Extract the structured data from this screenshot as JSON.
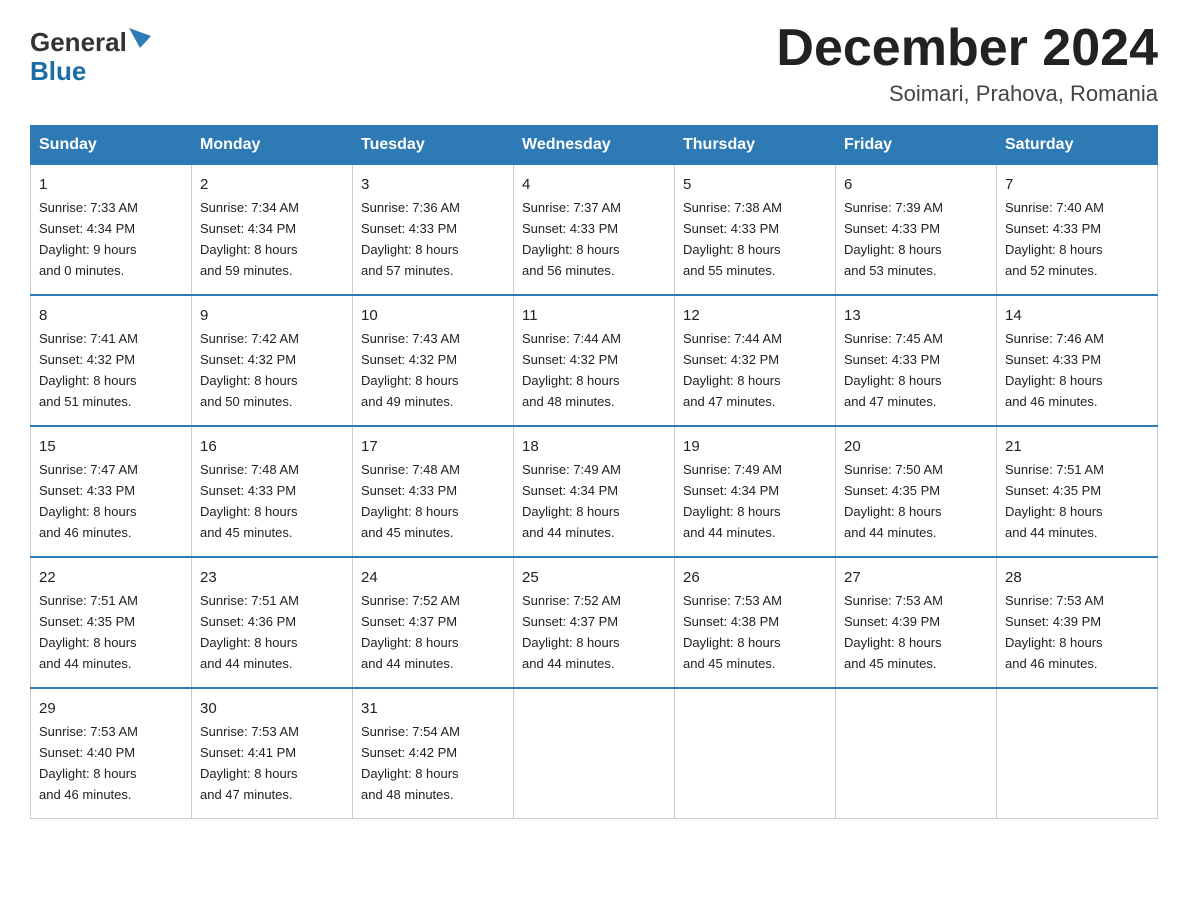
{
  "header": {
    "logo_general": "General",
    "logo_blue": "Blue",
    "month_title": "December 2024",
    "location": "Soimari, Prahova, Romania"
  },
  "days_of_week": [
    "Sunday",
    "Monday",
    "Tuesday",
    "Wednesday",
    "Thursday",
    "Friday",
    "Saturday"
  ],
  "weeks": [
    [
      {
        "day": "1",
        "sunrise": "7:33 AM",
        "sunset": "4:34 PM",
        "daylight": "9 hours and 0 minutes."
      },
      {
        "day": "2",
        "sunrise": "7:34 AM",
        "sunset": "4:34 PM",
        "daylight": "8 hours and 59 minutes."
      },
      {
        "day": "3",
        "sunrise": "7:36 AM",
        "sunset": "4:33 PM",
        "daylight": "8 hours and 57 minutes."
      },
      {
        "day": "4",
        "sunrise": "7:37 AM",
        "sunset": "4:33 PM",
        "daylight": "8 hours and 56 minutes."
      },
      {
        "day": "5",
        "sunrise": "7:38 AM",
        "sunset": "4:33 PM",
        "daylight": "8 hours and 55 minutes."
      },
      {
        "day": "6",
        "sunrise": "7:39 AM",
        "sunset": "4:33 PM",
        "daylight": "8 hours and 53 minutes."
      },
      {
        "day": "7",
        "sunrise": "7:40 AM",
        "sunset": "4:33 PM",
        "daylight": "8 hours and 52 minutes."
      }
    ],
    [
      {
        "day": "8",
        "sunrise": "7:41 AM",
        "sunset": "4:32 PM",
        "daylight": "8 hours and 51 minutes."
      },
      {
        "day": "9",
        "sunrise": "7:42 AM",
        "sunset": "4:32 PM",
        "daylight": "8 hours and 50 minutes."
      },
      {
        "day": "10",
        "sunrise": "7:43 AM",
        "sunset": "4:32 PM",
        "daylight": "8 hours and 49 minutes."
      },
      {
        "day": "11",
        "sunrise": "7:44 AM",
        "sunset": "4:32 PM",
        "daylight": "8 hours and 48 minutes."
      },
      {
        "day": "12",
        "sunrise": "7:44 AM",
        "sunset": "4:32 PM",
        "daylight": "8 hours and 47 minutes."
      },
      {
        "day": "13",
        "sunrise": "7:45 AM",
        "sunset": "4:33 PM",
        "daylight": "8 hours and 47 minutes."
      },
      {
        "day": "14",
        "sunrise": "7:46 AM",
        "sunset": "4:33 PM",
        "daylight": "8 hours and 46 minutes."
      }
    ],
    [
      {
        "day": "15",
        "sunrise": "7:47 AM",
        "sunset": "4:33 PM",
        "daylight": "8 hours and 46 minutes."
      },
      {
        "day": "16",
        "sunrise": "7:48 AM",
        "sunset": "4:33 PM",
        "daylight": "8 hours and 45 minutes."
      },
      {
        "day": "17",
        "sunrise": "7:48 AM",
        "sunset": "4:33 PM",
        "daylight": "8 hours and 45 minutes."
      },
      {
        "day": "18",
        "sunrise": "7:49 AM",
        "sunset": "4:34 PM",
        "daylight": "8 hours and 44 minutes."
      },
      {
        "day": "19",
        "sunrise": "7:49 AM",
        "sunset": "4:34 PM",
        "daylight": "8 hours and 44 minutes."
      },
      {
        "day": "20",
        "sunrise": "7:50 AM",
        "sunset": "4:35 PM",
        "daylight": "8 hours and 44 minutes."
      },
      {
        "day": "21",
        "sunrise": "7:51 AM",
        "sunset": "4:35 PM",
        "daylight": "8 hours and 44 minutes."
      }
    ],
    [
      {
        "day": "22",
        "sunrise": "7:51 AM",
        "sunset": "4:35 PM",
        "daylight": "8 hours and 44 minutes."
      },
      {
        "day": "23",
        "sunrise": "7:51 AM",
        "sunset": "4:36 PM",
        "daylight": "8 hours and 44 minutes."
      },
      {
        "day": "24",
        "sunrise": "7:52 AM",
        "sunset": "4:37 PM",
        "daylight": "8 hours and 44 minutes."
      },
      {
        "day": "25",
        "sunrise": "7:52 AM",
        "sunset": "4:37 PM",
        "daylight": "8 hours and 44 minutes."
      },
      {
        "day": "26",
        "sunrise": "7:53 AM",
        "sunset": "4:38 PM",
        "daylight": "8 hours and 45 minutes."
      },
      {
        "day": "27",
        "sunrise": "7:53 AM",
        "sunset": "4:39 PM",
        "daylight": "8 hours and 45 minutes."
      },
      {
        "day": "28",
        "sunrise": "7:53 AM",
        "sunset": "4:39 PM",
        "daylight": "8 hours and 46 minutes."
      }
    ],
    [
      {
        "day": "29",
        "sunrise": "7:53 AM",
        "sunset": "4:40 PM",
        "daylight": "8 hours and 46 minutes."
      },
      {
        "day": "30",
        "sunrise": "7:53 AM",
        "sunset": "4:41 PM",
        "daylight": "8 hours and 47 minutes."
      },
      {
        "day": "31",
        "sunrise": "7:54 AM",
        "sunset": "4:42 PM",
        "daylight": "8 hours and 48 minutes."
      },
      null,
      null,
      null,
      null
    ]
  ]
}
